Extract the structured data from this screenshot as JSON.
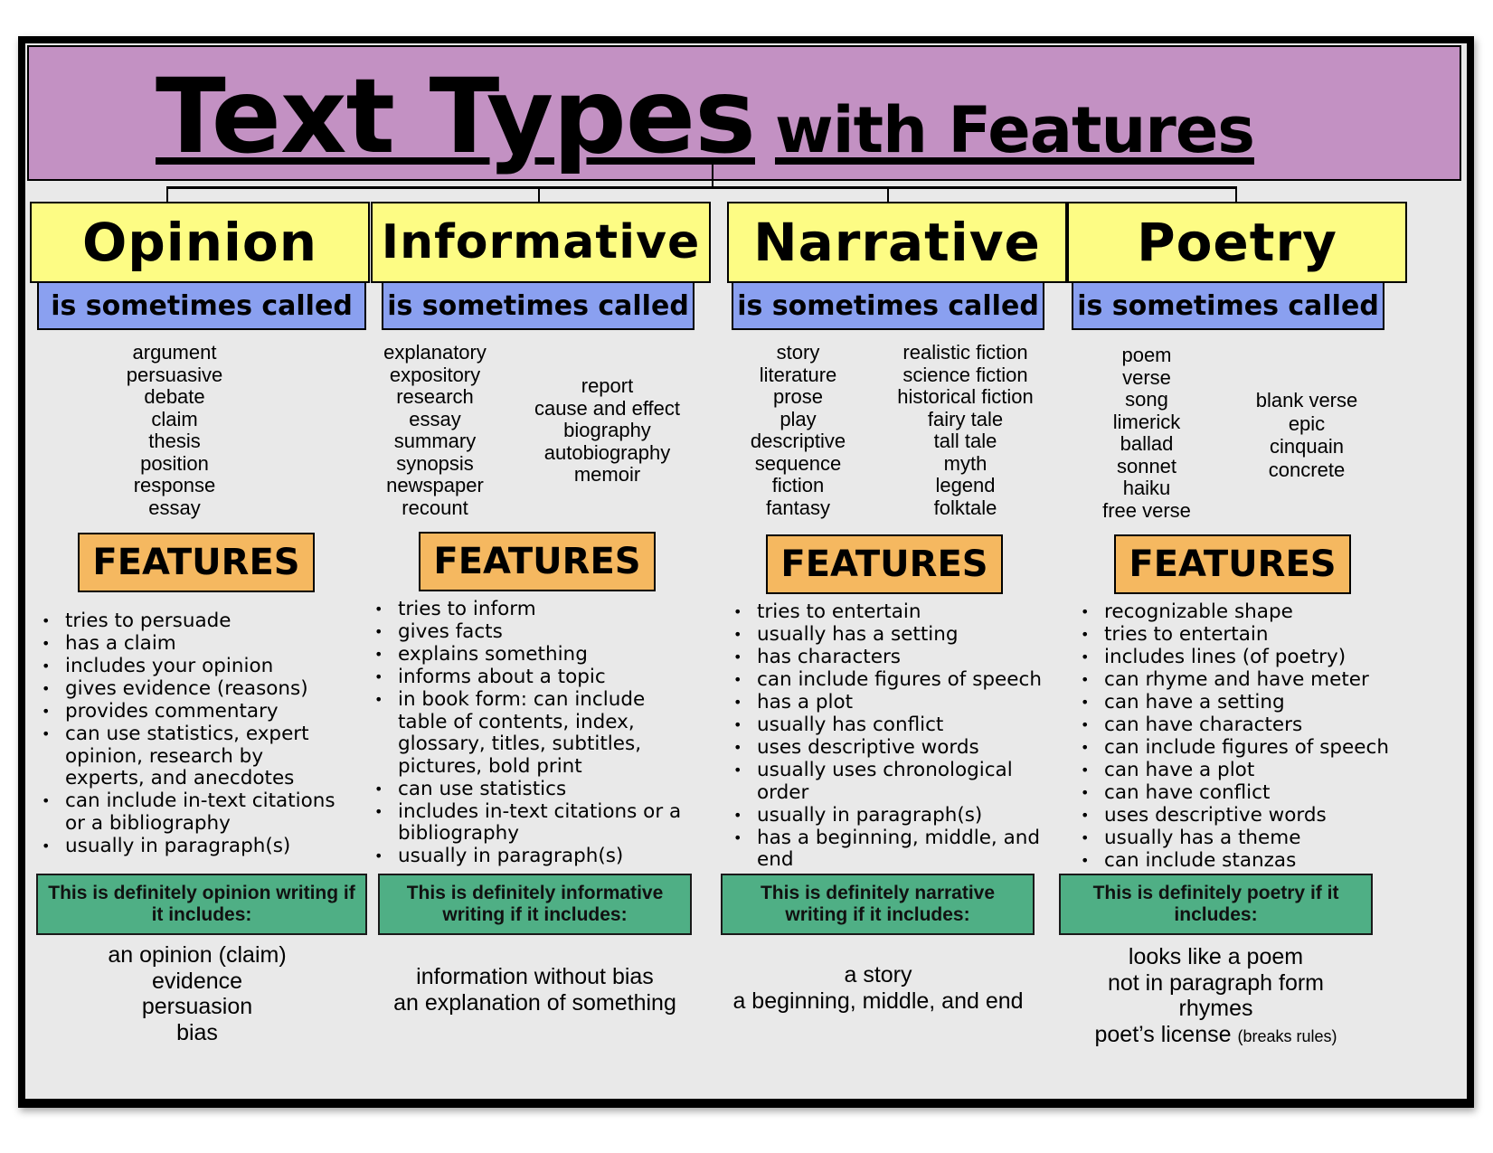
{
  "title": {
    "main": "Text Types",
    "sub": "with Features"
  },
  "colors": {
    "title_bg": "#c391c3",
    "category_bg": "#fdfc84",
    "alias_label_bg": "#8aa0f0",
    "features_bg": "#f5b860",
    "definitely_bg": "#4faf85",
    "panel_bg": "#e9e9e9"
  },
  "alias_label": "is sometimes called",
  "features_label": "FEATURES",
  "columns": [
    {
      "name": "Opinion",
      "aliases": [
        [
          "argument",
          "persuasive",
          "debate",
          "claim",
          "thesis",
          "position",
          "response",
          "essay"
        ]
      ],
      "features": [
        "tries to persuade",
        "has a claim",
        "includes your opinion",
        "gives evidence (reasons)",
        "provides commentary",
        "can use statistics, expert opinion, research by experts, and anecdotes",
        "can include in-text citations or a bibliography",
        "usually in paragraph(s)"
      ],
      "definitely_label": "This is definitely opinion writing if it includes:",
      "definitely": [
        "an opinion (claim)",
        "evidence",
        "persuasion",
        "bias"
      ]
    },
    {
      "name": "Informative",
      "aliases": [
        [
          "explanatory",
          "expository",
          "research",
          "essay",
          "summary",
          "synopsis",
          "newspaper",
          "recount"
        ],
        [
          "report",
          "cause and effect",
          "biography",
          "autobiography",
          "memoir"
        ]
      ],
      "features": [
        "tries to inform",
        "gives facts",
        "explains something",
        "informs about a topic",
        "in book form: can include table of contents, index, glossary, titles, subtitles, pictures, bold print",
        "can use statistics",
        "includes in-text citations or a bibliography",
        "usually in paragraph(s)"
      ],
      "definitely_label": "This is definitely informative writing if it includes:",
      "definitely": [
        "information without bias",
        "an explanation of something"
      ]
    },
    {
      "name": "Narrative",
      "aliases": [
        [
          "story",
          "literature",
          "prose",
          "play",
          "descriptive",
          "sequence",
          "fiction",
          "fantasy"
        ],
        [
          "realistic fiction",
          "science fiction",
          "historical fiction",
          "fairy tale",
          "tall tale",
          "myth",
          "legend",
          "folktale"
        ]
      ],
      "features": [
        "tries to entertain",
        "usually has a setting",
        "has characters",
        "can include figures of speech",
        "has a plot",
        "usually has conflict",
        "uses descriptive words",
        "usually uses chronological order",
        "usually in paragraph(s)",
        "has a beginning, middle, and end"
      ],
      "definitely_label": "This is definitely narrative writing if it includes:",
      "definitely": [
        "a story",
        "a beginning, middle, and end"
      ]
    },
    {
      "name": "Poetry",
      "aliases": [
        [
          "poem",
          "verse",
          "song",
          "limerick",
          "ballad",
          "sonnet",
          "haiku",
          "free verse"
        ],
        [
          "blank verse",
          "epic",
          "cinquain",
          "concrete"
        ]
      ],
      "features": [
        "recognizable shape",
        "tries to entertain",
        "includes lines (of poetry)",
        "can rhyme and have meter",
        "can have a setting",
        "can have characters",
        "can include figures of speech",
        "can have a plot",
        "can have conflict",
        "uses descriptive words",
        "usually has a theme",
        "can include stanzas"
      ],
      "definitely_label": "This is definitely poetry if it includes:",
      "definitely": [
        "looks like a poem",
        "not in paragraph form",
        "rhymes",
        "poet’s license"
      ],
      "definitely_note": "(breaks rules)"
    }
  ]
}
